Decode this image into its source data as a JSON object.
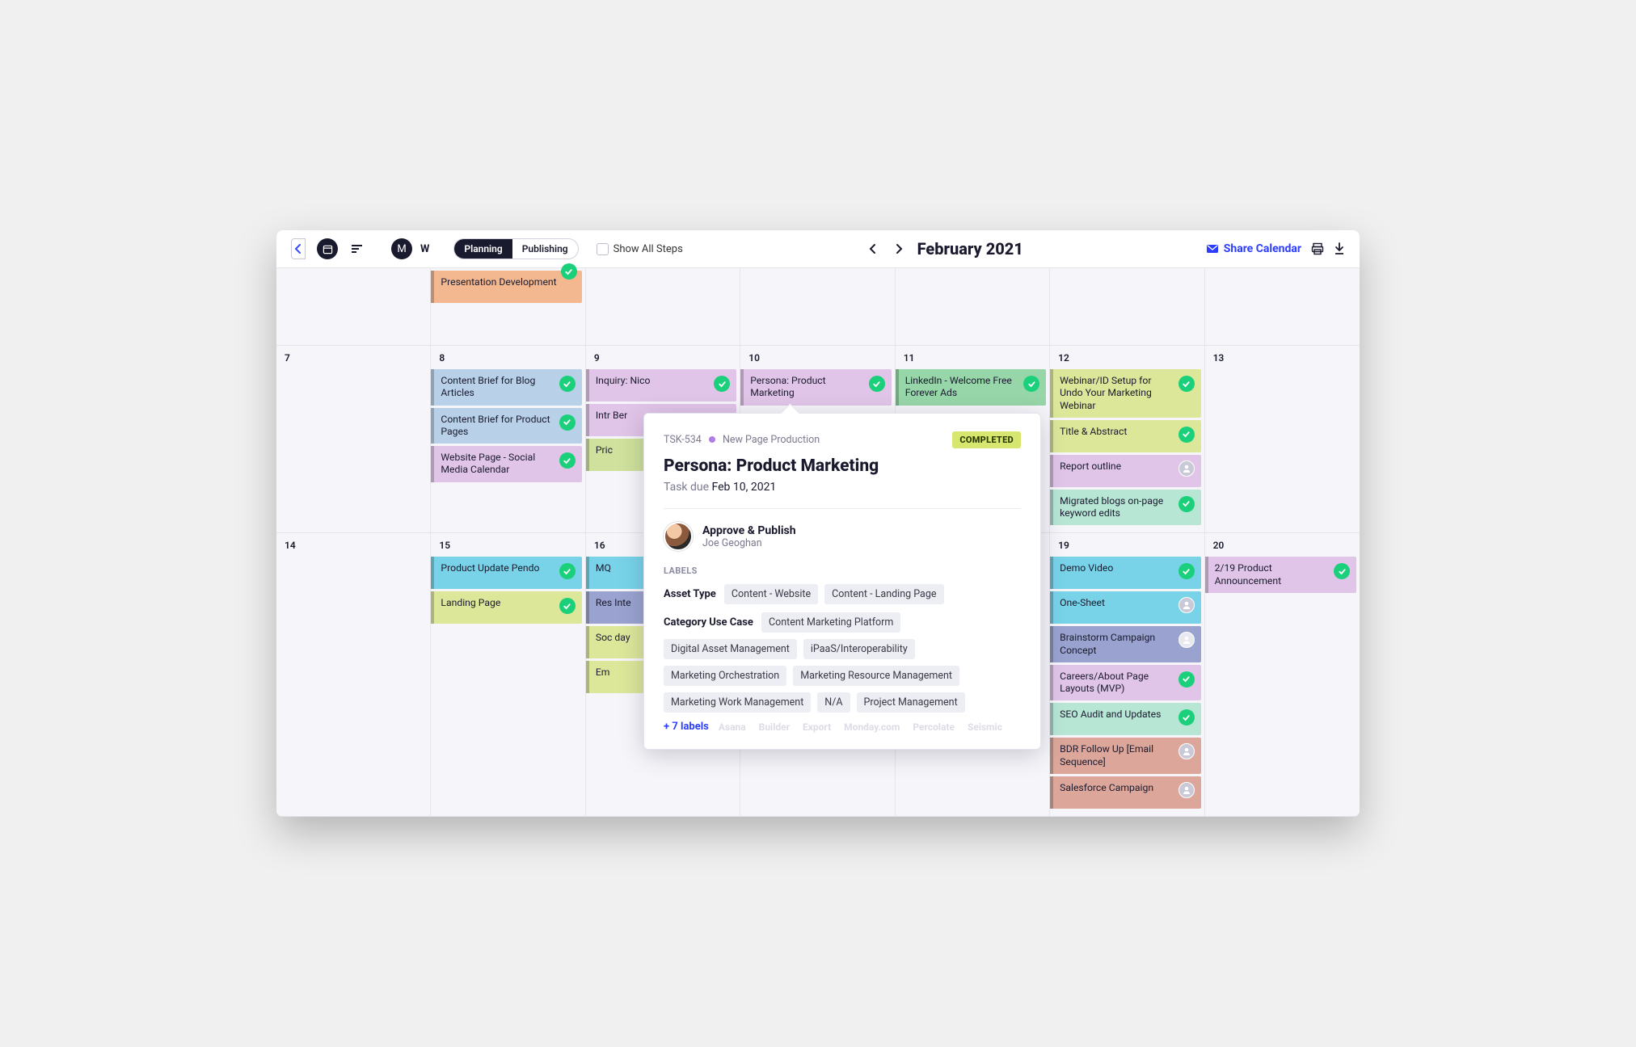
{
  "header": {
    "avatar_letter": "M",
    "mode_letter": "W",
    "toggle": {
      "planning": "Planning",
      "publishing": "Publishing"
    },
    "show_all": "Show All Steps",
    "month": "February 2021",
    "share": "Share Calendar"
  },
  "rows": [
    {
      "partial": true,
      "days": [
        "",
        "",
        "",
        "",
        "",
        "",
        ""
      ],
      "cells": {
        "1": [
          {
            "text": "Presentation Development",
            "color": "#f3b890",
            "check": true,
            "chip_top": true
          }
        ]
      }
    },
    {
      "days": [
        "7",
        "8",
        "9",
        "10",
        "11",
        "12",
        "13"
      ],
      "cells": {
        "1": [
          {
            "text": "Content Brief for Blog Articles",
            "color": "#b8d1e8",
            "check": true
          },
          {
            "text": "Content Brief for Product Pages",
            "color": "#b8d1e8",
            "check": true
          },
          {
            "text": "Website Page - Social Media Calendar",
            "color": "#e1c5e8",
            "check": true
          }
        ],
        "2": [
          {
            "text": "Inquiry: Nico",
            "color": "#e1c5e8",
            "check": true
          },
          {
            "text": "Intr\nBer",
            "color": "#e1c5e8",
            "check": false,
            "cut": true
          },
          {
            "text": "Pric",
            "color": "#cfe19c",
            "check": false,
            "cut": true
          }
        ],
        "3": [
          {
            "text": "Persona: Product Marketing",
            "color": "#e1c5e8",
            "check": true
          }
        ],
        "4": [
          {
            "text": "LinkedIn - Welcome Free Forever Ads",
            "color": "#97d6a8",
            "check": true
          }
        ],
        "5": [
          {
            "text": "Webinar/ID Setup for Undo Your Marketing Webinar",
            "color": "#dde79a",
            "check": true
          },
          {
            "text": "Title & Abstract",
            "color": "#dde79a",
            "check": true
          },
          {
            "text": "Report outline",
            "color": "#e1c5e8",
            "avatar": true
          },
          {
            "text": "Migrated blogs on-page keyword edits",
            "color": "#b7e6d5",
            "check": true
          }
        ]
      }
    },
    {
      "days": [
        "14",
        "15",
        "16",
        "",
        "",
        "19",
        "20"
      ],
      "cells": {
        "1": [
          {
            "text": "Product Update Pendo",
            "color": "#78d3e8",
            "check": true
          },
          {
            "text": "Landing Page",
            "color": "#dde79a",
            "check": true
          }
        ],
        "2": [
          {
            "text": "MQ",
            "color": "#78d3e8",
            "cut": true
          },
          {
            "text": "Res\nInte",
            "color": "#9aa3cf",
            "cut": true,
            "avatar": true
          },
          {
            "text": "Soc\nday",
            "color": "#dde79a",
            "cut": true
          },
          {
            "text": "Em",
            "color": "#dde79a",
            "cut": true
          }
        ],
        "5": [
          {
            "text": "Demo Video",
            "color": "#78d3e8",
            "check": true
          },
          {
            "text": "One-Sheet",
            "color": "#78d3e8",
            "avatar": true
          },
          {
            "text": "Brainstorm Campaign Concept",
            "color": "#9aa3cf",
            "avatar": true,
            "light": true
          },
          {
            "text": "Careers/About Page Layouts (MVP)",
            "color": "#e1c5e8",
            "check": true
          },
          {
            "text": "SEO Audit and Updates",
            "color": "#b7e6d5",
            "check": true
          },
          {
            "text": "BDR Follow Up [Email Sequence]",
            "color": "#dca79a",
            "avatar": true
          },
          {
            "text": "Salesforce Campaign",
            "color": "#dca79a",
            "avatar": true
          }
        ],
        "6": [
          {
            "text": "2/19 Product Announcement",
            "color": "#e1c5e8",
            "check": true
          }
        ]
      }
    }
  ],
  "popover": {
    "task_id": "TSK-534",
    "project": "New Page Production",
    "status": "COMPLETED",
    "title": "Persona: Product Marketing",
    "due_label": "Task due",
    "due_date": "Feb 10, 2021",
    "step_name": "Approve & Publish",
    "assignee": "Joe Geoghan",
    "labels_header": "LABELS",
    "groups": [
      {
        "name": "Asset Type",
        "tags": [
          "Content - Website",
          "Content - Landing Page"
        ]
      },
      {
        "name": "Category Use Case",
        "tags": [
          "Content Marketing Platform",
          "Digital Asset Management",
          "iPaaS/Interoperability",
          "Marketing Orchestration",
          "Marketing Resource Management",
          "Marketing Work Management",
          "N/A",
          "Project Management"
        ]
      }
    ],
    "more": "+ 7 labels",
    "ghost_tags": [
      "Asana",
      "Builder",
      "Export",
      "Monday.com",
      "Percolate",
      "Seismic"
    ]
  }
}
